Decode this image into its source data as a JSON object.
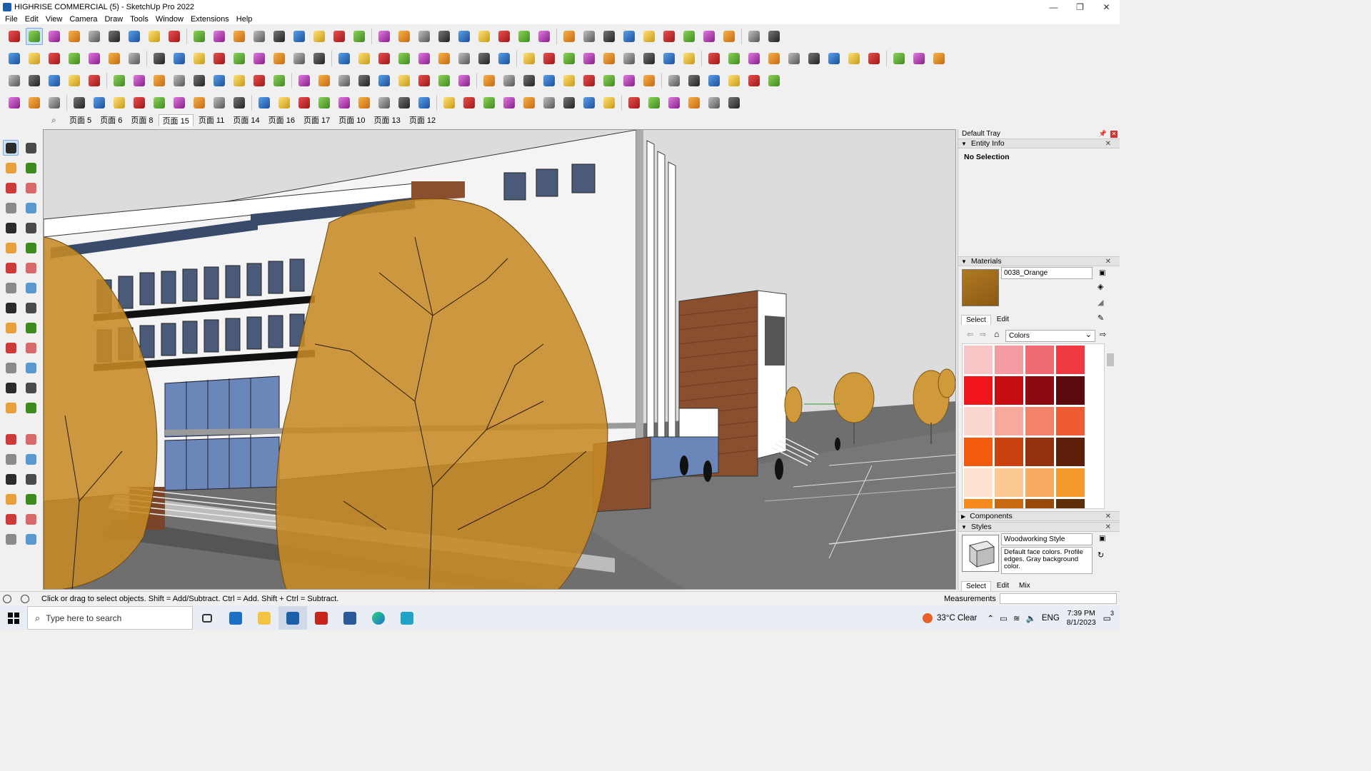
{
  "window": {
    "title": "HIGHRISE COMMERCIAL (5) - SketchUp Pro 2022",
    "controls": [
      "—",
      "❐",
      "✕"
    ]
  },
  "menu": [
    "File",
    "Edit",
    "View",
    "Camera",
    "Draw",
    "Tools",
    "Window",
    "Extensions",
    "Help"
  ],
  "scenes": {
    "search_icon": "magnifier-icon",
    "tabs": [
      "页面 5",
      "页面 6",
      "页面 8",
      "页面 15",
      "页面 11",
      "页面 14",
      "页面 16",
      "页面 17",
      "页面 10",
      "页面 13",
      "页面 12"
    ],
    "active_index": 3
  },
  "tray": {
    "title": "Default Tray",
    "entity_info": {
      "heading": "Entity Info",
      "selection": "No Selection"
    },
    "materials": {
      "heading": "Materials",
      "current_name": "0038_Orange",
      "current_color": "#9c6a1c",
      "tabs": [
        "Select",
        "Edit"
      ],
      "active_tab": "Select",
      "library": "Colors",
      "swatches": [
        "#f9c6c8",
        "#f59ca3",
        "#f06a72",
        "#ee3a40",
        "#f0141b",
        "#c80d12",
        "#8c0b10",
        "#5a0a0c",
        "#fbd5cf",
        "#f7aa9c",
        "#f3826a",
        "#ef5c32",
        "#f25a0d",
        "#c9420f",
        "#93300d",
        "#5e1f0a",
        "#fde3cf",
        "#fbc894",
        "#f7ac62",
        "#f49a2e",
        "#f58b1e",
        "#c8680f",
        "#96490a",
        "#5e2e08"
      ]
    },
    "components": {
      "heading": "Components"
    },
    "styles": {
      "heading": "Styles",
      "name": "Woodworking Style",
      "description": "Default face colors. Profile edges. Gray background color.",
      "tabs": [
        "Select",
        "Edit",
        "Mix"
      ],
      "active_tab": "Select"
    }
  },
  "status": {
    "text": "Click or drag to select objects. Shift = Add/Subtract. Ctrl = Add. Shift + Ctrl = Subtract.",
    "measurements_label": "Measurements",
    "measurements_value": ""
  },
  "taskbar": {
    "search_placeholder": "Type here to search",
    "weather": "33°C  Clear",
    "language": "ENG",
    "time": "7:39 PM",
    "date": "8/1/2023",
    "notification_count": "3"
  }
}
